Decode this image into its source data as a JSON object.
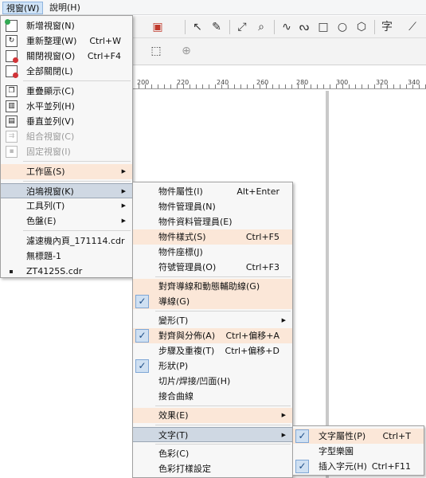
{
  "menubar": {
    "window": "視窗(W)",
    "help": "說明(H)"
  },
  "toolbar": {
    "text_tool": "字"
  },
  "ruler": {
    "labels": [
      "200",
      "220",
      "240",
      "260",
      "280",
      "300",
      "320",
      "340"
    ]
  },
  "window_menu": {
    "new_window": "新增視窗(N)",
    "refresh_window": "重新整理(W)",
    "refresh_shortcut": "Ctrl+W",
    "close_window": "關閉視窗(O)",
    "close_shortcut": "Ctrl+F4",
    "close_all": "全部關閉(L)",
    "cascade": "重疊顯示(C)",
    "tile_horizontal": "水平並列(H)",
    "tile_vertical": "垂直並列(V)",
    "combine_windows": "組合視窗(C)",
    "dock_window": "固定視窗(I)",
    "workspace": "工作區(S)",
    "dockers": "泊塢視窗(K)",
    "toolbars": "工具列(T)",
    "palettes": "色盤(E)",
    "doc1": "濾速機內頁_171114.cdr",
    "doc2": "無標題-1",
    "doc3": "ZT4125S.cdr"
  },
  "dockers_menu": {
    "object_properties": "物件屬性(I)",
    "object_properties_shortcut": "Alt+Enter",
    "object_manager": "物件管理員(N)",
    "object_data_manager": "物件資料管理員(E)",
    "object_styles": "物件樣式(S)",
    "object_styles_shortcut": "Ctrl+F5",
    "object_coordinates": "物件座標(J)",
    "symbol_manager": "符號管理員(O)",
    "symbol_manager_shortcut": "Ctrl+F3",
    "alignment_guides": "對齊導線和動態輔助線(G)",
    "guidelines": "導線(G)",
    "transformations": "變形(T)",
    "align_distribute": "對齊與分佈(A)",
    "align_distribute_shortcut": "Ctrl+偏移+A",
    "step_repeat": "步驟及重複(T)",
    "step_repeat_shortcut": "Ctrl+偏移+D",
    "shaping": "形狀(P)",
    "slice_weld": "切片/焊接/凹面(H)",
    "join_curves": "接合曲線",
    "effects": "效果(E)",
    "text": "文字(T)",
    "color": "色彩(C)",
    "color_proofing": "色彩打樣設定"
  },
  "text_menu": {
    "text_properties": "文字屬性(P)",
    "text_properties_shortcut": "Ctrl+T",
    "font_playground": "字型樂園",
    "insert_character": "插入字元(H)",
    "insert_character_shortcut": "Ctrl+F11"
  }
}
